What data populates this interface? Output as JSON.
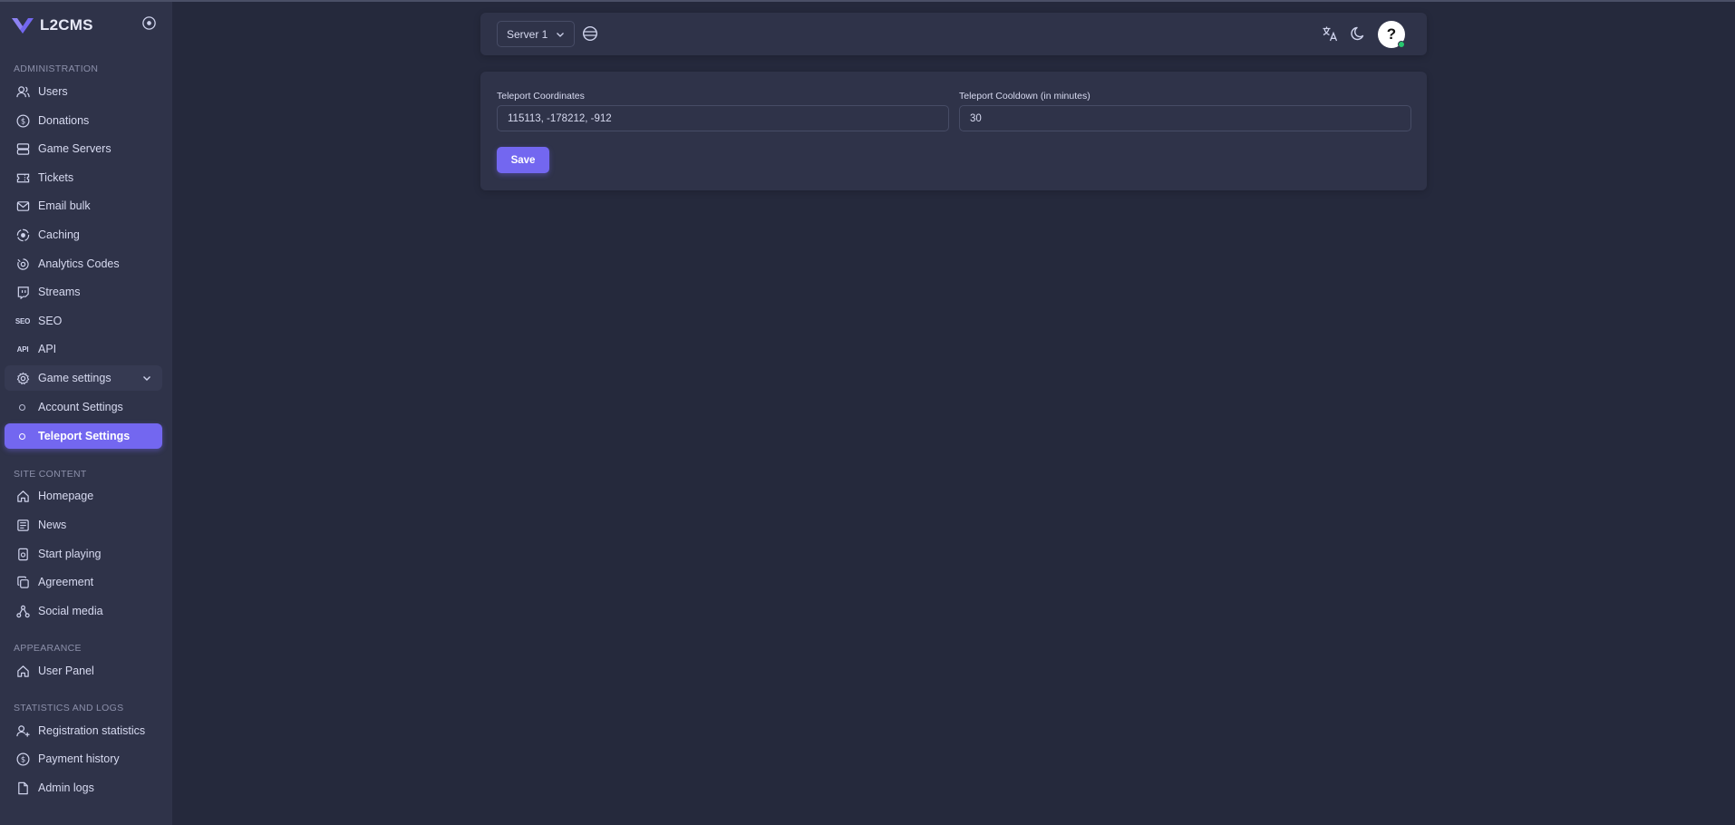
{
  "brand": {
    "name": "L2CMS"
  },
  "sidebar": {
    "sections": {
      "administration": "ADMINISTRATION",
      "site_content": "SITE CONTENT",
      "appearance": "APPEARANCE",
      "statistics": "STATISTICS AND LOGS"
    },
    "admin_items": [
      {
        "label": "Users",
        "icon": "users-icon"
      },
      {
        "label": "Donations",
        "icon": "dollar-icon"
      },
      {
        "label": "Game Servers",
        "icon": "server-icon"
      },
      {
        "label": "Tickets",
        "icon": "ticket-icon"
      },
      {
        "label": "Email bulk",
        "icon": "mail-icon"
      },
      {
        "label": "Caching",
        "icon": "caching-icon"
      },
      {
        "label": "Analytics Codes",
        "icon": "analytics-icon"
      },
      {
        "label": "Streams",
        "icon": "twitch-icon"
      },
      {
        "label": "SEO",
        "icon": "seo-text-icon",
        "icon_text": "SEO"
      },
      {
        "label": "API",
        "icon": "api-text-icon",
        "icon_text": "API"
      }
    ],
    "game_settings": {
      "label": "Game settings",
      "children": [
        {
          "label": "Account Settings",
          "active": false
        },
        {
          "label": "Teleport Settings",
          "active": true
        }
      ]
    },
    "site_items": [
      {
        "label": "Homepage",
        "icon": "home-icon"
      },
      {
        "label": "News",
        "icon": "news-icon"
      },
      {
        "label": "Start playing",
        "icon": "download-icon"
      },
      {
        "label": "Agreement",
        "icon": "copy-icon"
      },
      {
        "label": "Social media",
        "icon": "share-icon"
      }
    ],
    "appearance_items": [
      {
        "label": "User Panel",
        "icon": "home-icon"
      }
    ],
    "stats_items": [
      {
        "label": "Registration statistics",
        "icon": "user-plus-icon"
      },
      {
        "label": "Payment history",
        "icon": "dollar-icon"
      },
      {
        "label": "Admin logs",
        "icon": "file-icon"
      }
    ]
  },
  "navbar": {
    "server_select": "Server 1",
    "avatar_glyph": "?"
  },
  "form": {
    "coordinates_label": "Teleport Coordinates",
    "coordinates_value": "115113, -178212, -912",
    "cooldown_label": "Teleport Cooldown (in minutes)",
    "cooldown_value": "30",
    "save_label": "Save"
  },
  "colors": {
    "accent": "#7367f0",
    "background": "#25293c",
    "surface": "#2f3349",
    "online": "#28c76f"
  }
}
